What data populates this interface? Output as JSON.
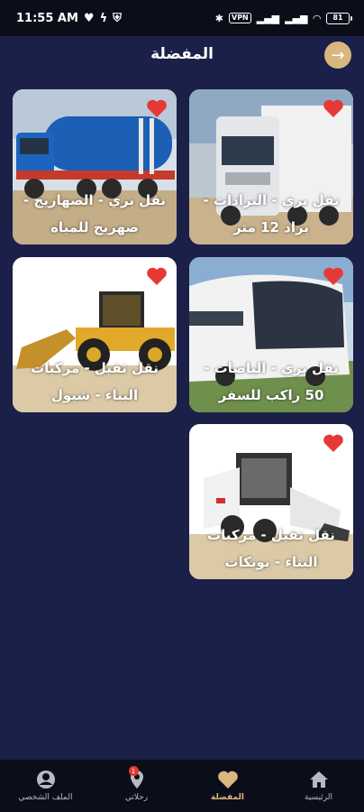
{
  "status_bar": {
    "time": "11:55 AM",
    "vpn": "VPN",
    "battery": "81"
  },
  "header": {
    "title": "المفضلة"
  },
  "favorites": [
    {
      "title": "نقل بري - البرادات - براد 12 متر",
      "icon": "refrigerated-truck",
      "favorited": true
    },
    {
      "title": "نقل بري - الصهاريج - صهريج للمياه",
      "icon": "water-tanker-truck",
      "favorited": true
    },
    {
      "title": "نقل بري - الباصات - 50 راكب للسفر",
      "icon": "coach-bus",
      "favorited": true
    },
    {
      "title": "نقل ثقيل - مركبات البناء - شيول",
      "icon": "wheel-loader",
      "favorited": true
    },
    {
      "title": "نقل ثقيل - مركبات البناء - بوبكات",
      "icon": "skid-steer-loader",
      "favorited": true
    }
  ],
  "bottom_nav": {
    "home": "الرئيسية",
    "favorites": "المفضلة",
    "trips": "رحلاتي",
    "trips_badge": "1",
    "profile": "الملف الشخصي"
  },
  "colors": {
    "background": "#1a2048",
    "accent": "#d9b77f",
    "heart": "#e53935"
  }
}
